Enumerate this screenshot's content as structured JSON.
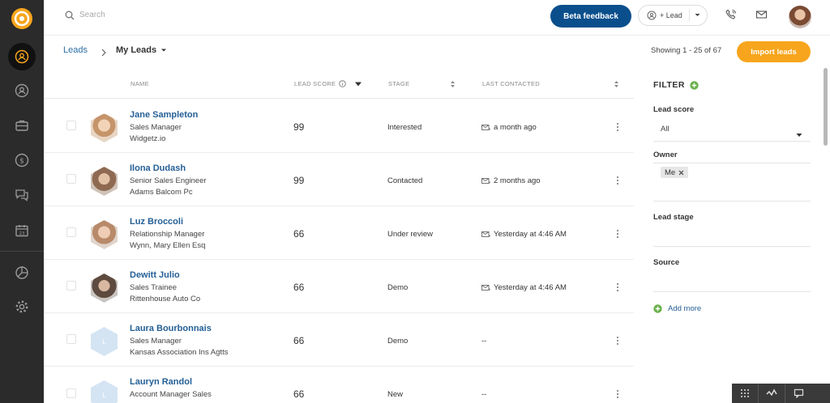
{
  "topbar": {
    "search_placeholder": "Search",
    "beta_label": "Beta feedback",
    "add_lead_label": "+ Lead"
  },
  "breadcrumb": {
    "root": "Leads",
    "current": "My Leads"
  },
  "showing": "Showing 1 - 25 of 67",
  "import_label": "Import leads",
  "columns": {
    "name": "NAME",
    "lead_score": "LEAD SCORE",
    "stage": "STAGE",
    "last_contacted": "LAST CONTACTED"
  },
  "leads": [
    {
      "name": "Jane Sampleton",
      "title": "Sales Manager",
      "company": "Widgetz.io",
      "score": "99",
      "stage": "Interested",
      "contacted": "a month ago",
      "photo": true,
      "initial": ""
    },
    {
      "name": "Ilona Dudash",
      "title": "Senior Sales Engineer",
      "company": "Adams Balcom Pc",
      "score": "99",
      "stage": "Contacted",
      "contacted": "2 months ago",
      "photo": true,
      "initial": ""
    },
    {
      "name": "Luz Broccoli",
      "title": "Relationship Manager",
      "company": "Wynn, Mary Ellen Esq",
      "score": "66",
      "stage": "Under review",
      "contacted": "Yesterday at 4:46 AM",
      "photo": true,
      "initial": ""
    },
    {
      "name": "Dewitt Julio",
      "title": "Sales Trainee",
      "company": "Rittenhouse Auto Co",
      "score": "66",
      "stage": "Demo",
      "contacted": "Yesterday at 4:46 AM",
      "photo": true,
      "initial": ""
    },
    {
      "name": "Laura Bourbonnais",
      "title": "Sales Manager",
      "company": "Kansas Association Ins Agtts",
      "score": "66",
      "stage": "Demo",
      "contacted": "--",
      "photo": false,
      "initial": "L"
    },
    {
      "name": "Lauryn Randol",
      "title": "Account Manager Sales",
      "company": "",
      "score": "66",
      "stage": "New",
      "contacted": "--",
      "photo": false,
      "initial": "L"
    }
  ],
  "filter": {
    "title": "FILTER",
    "lead_score_label": "Lead score",
    "lead_score_value": "All",
    "owner_label": "Owner",
    "owner_chip": "Me",
    "lead_stage_label": "Lead stage",
    "source_label": "Source",
    "add_more": "Add more"
  },
  "colors": {
    "sidebar": "#2b2b2b",
    "accent_blue": "#0a4f8c",
    "link_blue": "#245f95",
    "import_orange": "#f7a51c",
    "add_green": "#6ab04c"
  }
}
